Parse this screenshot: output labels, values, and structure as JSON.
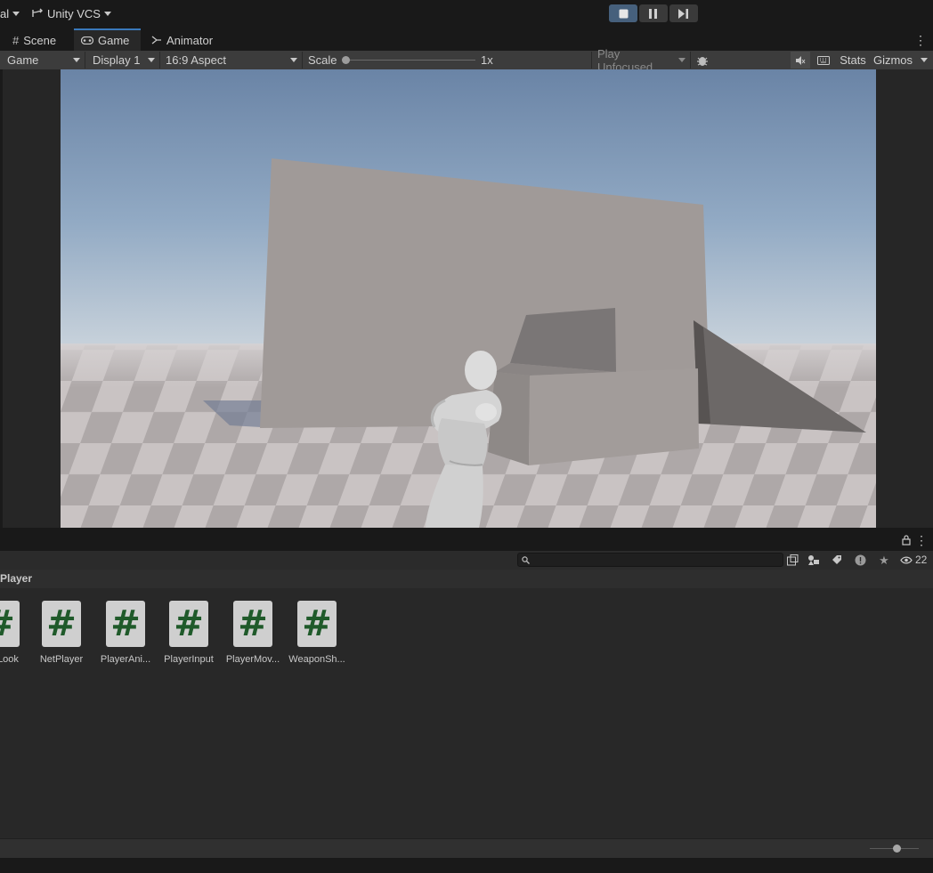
{
  "topbar": {
    "layout_fragment": "al",
    "vcs_label": "Unity VCS"
  },
  "tabs": [
    {
      "label": "Scene",
      "icon": "hash-grid-icon"
    },
    {
      "label": "Game",
      "icon": "gamepad-icon"
    },
    {
      "label": "Animator",
      "icon": "animator-icon"
    }
  ],
  "game_toolbar": {
    "view_mode": "Game",
    "display": "Display 1",
    "aspect": "16:9 Aspect",
    "scale_label": "Scale",
    "scale_value": "1x",
    "scale_fraction": 0.0,
    "play_mode": "Play Unfocused",
    "stats_label": "Stats",
    "gizmos_label": "Gizmos"
  },
  "project": {
    "breadcrumb": "Player",
    "visible_count": "22",
    "search_placeholder": "",
    "assets": [
      {
        "label": "Look"
      },
      {
        "label": "NetPlayer"
      },
      {
        "label": "PlayerAni..."
      },
      {
        "label": "PlayerInput"
      },
      {
        "label": "PlayerMov..."
      },
      {
        "label": "WeaponSh..."
      }
    ],
    "zoom_fraction": 0.55
  },
  "colors": {
    "accent": "#3a79bb",
    "script_hash": "#1f5a2a",
    "active_play": "#46607c"
  }
}
